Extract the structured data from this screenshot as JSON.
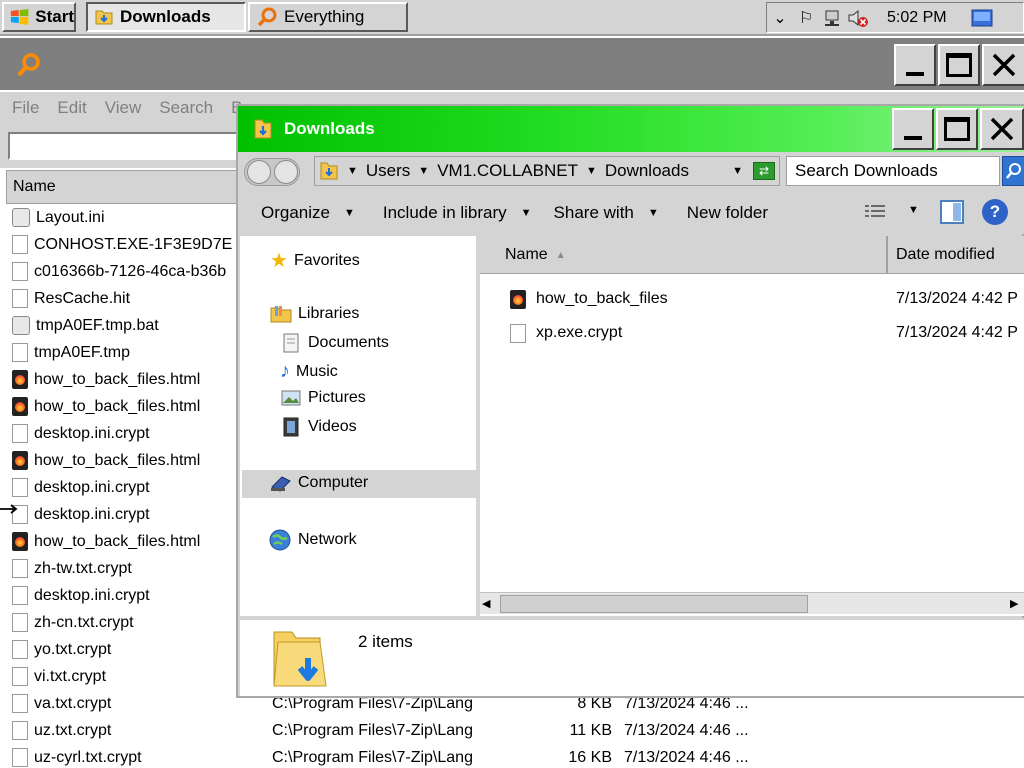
{
  "taskbar": {
    "start_label": "Start",
    "buttons": [
      {
        "label": "Downloads"
      },
      {
        "label": "Everything"
      }
    ],
    "clock": "5:02 PM"
  },
  "everything": {
    "menu": [
      "File",
      "Edit",
      "View",
      "Search",
      "B"
    ],
    "columns": {
      "name": "Name"
    },
    "rows": [
      {
        "name": "Layout.ini",
        "icon": "config-icon"
      },
      {
        "name": "CONHOST.EXE-1F3E9D7E",
        "icon": "file-icon"
      },
      {
        "name": "c016366b-7126-46ca-b36b",
        "icon": "file-icon"
      },
      {
        "name": "ResCache.hit",
        "icon": "file-icon"
      },
      {
        "name": "tmpA0EF.tmp.bat",
        "icon": "config-icon"
      },
      {
        "name": "tmpA0EF.tmp",
        "icon": "file-icon"
      },
      {
        "name": "how_to_back_files.html",
        "icon": "html-icon"
      },
      {
        "name": "how_to_back_files.html",
        "icon": "html-icon"
      },
      {
        "name": "desktop.ini.crypt",
        "icon": "file-icon"
      },
      {
        "name": "how_to_back_files.html",
        "icon": "html-icon"
      },
      {
        "name": "desktop.ini.crypt",
        "icon": "file-icon"
      },
      {
        "name": "desktop.ini.crypt",
        "icon": "file-icon"
      },
      {
        "name": "how_to_back_files.html",
        "icon": "html-icon"
      },
      {
        "name": "zh-tw.txt.crypt",
        "icon": "file-icon"
      },
      {
        "name": "desktop.ini.crypt",
        "icon": "file-icon"
      },
      {
        "name": "zh-cn.txt.crypt",
        "icon": "file-icon"
      },
      {
        "name": "yo.txt.crypt",
        "icon": "file-icon"
      },
      {
        "name": "vi.txt.crypt",
        "icon": "file-icon"
      },
      {
        "name": "va.txt.crypt",
        "icon": "file-icon",
        "path": "C:\\Program Files\\7-Zip\\Lang",
        "size": "8 KB",
        "date": "7/13/2024 4:46 ..."
      },
      {
        "name": "uz.txt.crypt",
        "icon": "file-icon",
        "path": "C:\\Program Files\\7-Zip\\Lang",
        "size": "11 KB",
        "date": "7/13/2024 4:46 ..."
      },
      {
        "name": "uz-cyrl.txt.crypt",
        "icon": "file-icon",
        "path": "C:\\Program Files\\7-Zip\\Lang",
        "size": "16 KB",
        "date": "7/13/2024 4:46 ..."
      }
    ]
  },
  "explorer": {
    "title": "Downloads",
    "breadcrumb": [
      "Users",
      "VM1.COLLABNET",
      "Downloads"
    ],
    "search_placeholder": "Search Downloads",
    "toolbar": {
      "organize": "Organize",
      "include": "Include in library",
      "share": "Share with",
      "new_folder": "New folder"
    },
    "nav": {
      "favorites": "Favorites",
      "libraries": "Libraries",
      "documents": "Documents",
      "music": "Music",
      "pictures": "Pictures",
      "videos": "Videos",
      "computer": "Computer",
      "network": "Network"
    },
    "columns": {
      "name": "Name",
      "date": "Date modified"
    },
    "files": [
      {
        "name": "how_to_back_files",
        "date": "7/13/2024 4:42 P",
        "icon": "html-icon"
      },
      {
        "name": "xp.exe.crypt",
        "date": "7/13/2024 4:42 P",
        "icon": "file-icon"
      }
    ],
    "status": "2 items"
  }
}
